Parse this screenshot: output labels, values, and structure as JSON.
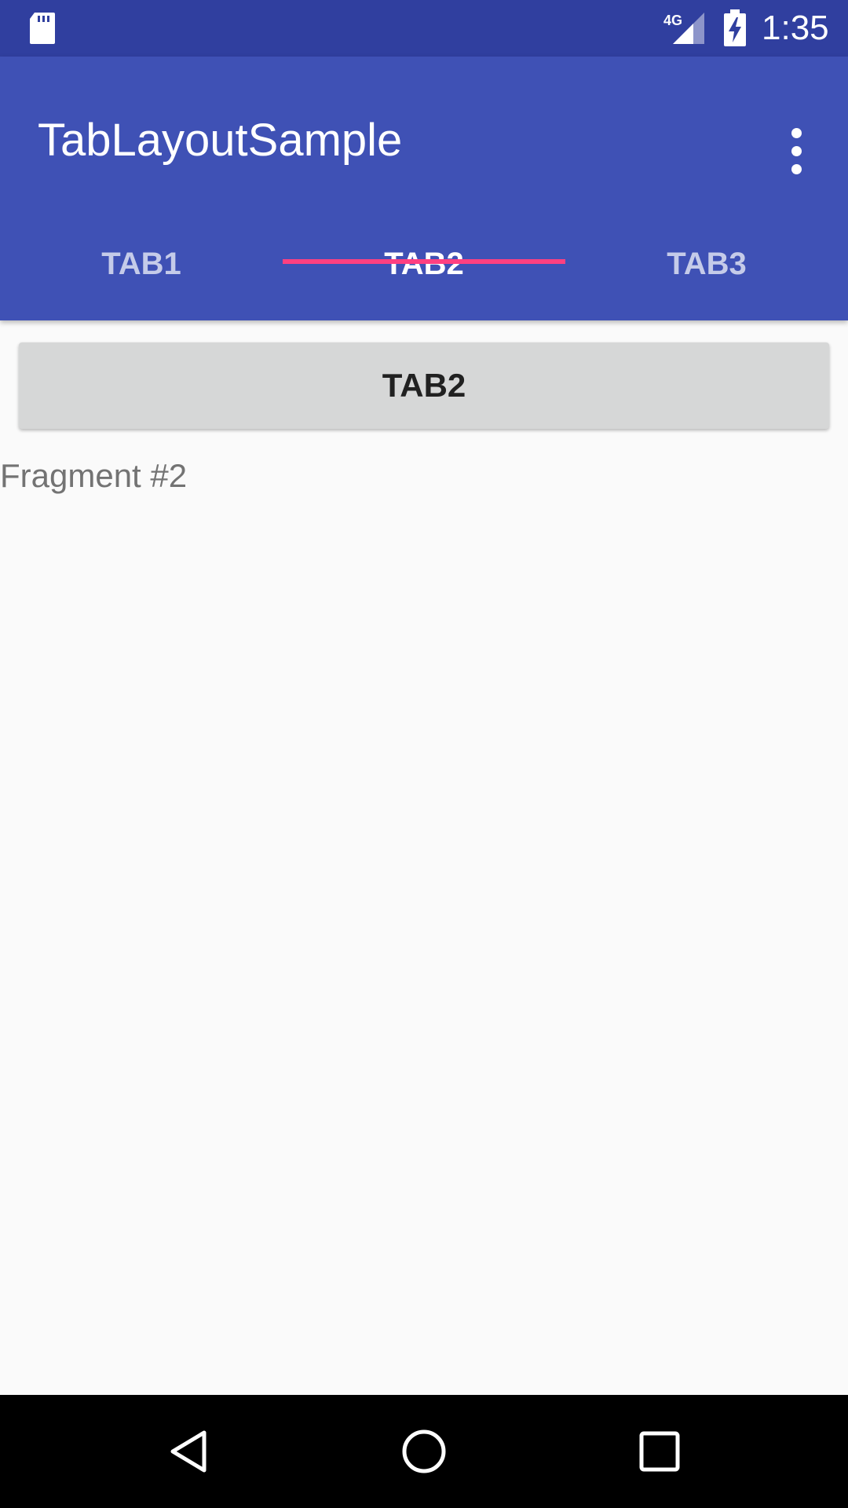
{
  "status_bar": {
    "time": "1:35",
    "network": "4G",
    "icons": [
      "sd-card-icon",
      "signal-4g-icon",
      "battery-charging-icon"
    ]
  },
  "app_bar": {
    "title": "TabLayoutSample",
    "menu_icon": "more-vert-icon"
  },
  "tabs": [
    {
      "label": "TAB1",
      "selected": false
    },
    {
      "label": "TAB2",
      "selected": true
    },
    {
      "label": "TAB3",
      "selected": false
    }
  ],
  "content": {
    "button_label": "TAB2",
    "fragment_text": "Fragment #2"
  },
  "nav_bar": {
    "icons": [
      "back-icon",
      "home-icon",
      "recents-icon"
    ]
  },
  "colors": {
    "status_bar": "#303f9f",
    "primary": "#3f51b5",
    "accent": "#ff4081",
    "background": "#fafafa",
    "button": "#d6d7d7"
  }
}
